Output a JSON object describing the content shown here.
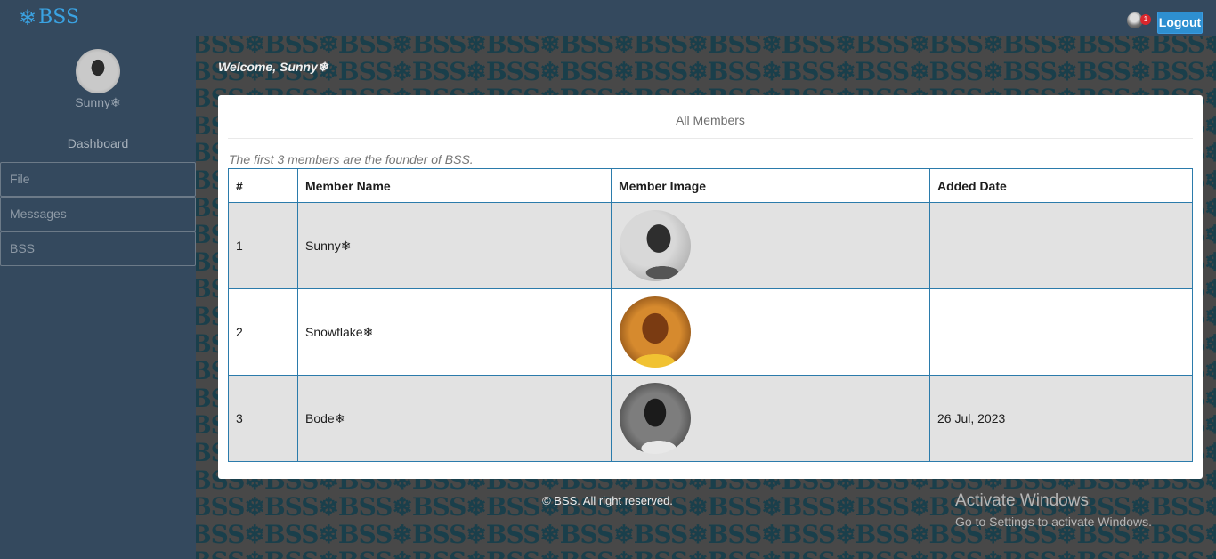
{
  "header": {
    "brand_icon": "❄",
    "brand_name": "BSS",
    "notification_count": "1",
    "logout_label": "Logout"
  },
  "sidebar": {
    "user_name": "Sunny❄",
    "dashboard_label": "Dashboard",
    "items": [
      {
        "label": "File"
      },
      {
        "label": "Messages"
      },
      {
        "label": "BSS"
      }
    ]
  },
  "main": {
    "welcome": "Welcome, Sunny❄",
    "card_title": "All Members",
    "founder_note": "The first 3 members are the founder of BSS.",
    "columns": [
      "#",
      "Member Name",
      "Member Image",
      "Added Date"
    ],
    "rows": [
      {
        "num": "1",
        "name": "Sunny❄",
        "date": ""
      },
      {
        "num": "2",
        "name": "Snowflake❄",
        "date": ""
      },
      {
        "num": "3",
        "name": "Bode❄",
        "date": "26 Jul, 2023"
      }
    ],
    "footer": "© BSS. All right reserved."
  },
  "overlay": {
    "activate_title": "Activate Windows",
    "activate_sub": "Go to Settings to activate Windows."
  },
  "colors": {
    "topbar": "#34495e",
    "sidebar": "#34495e",
    "brand": "#3aa3e3",
    "logout": "#2e8fd0",
    "table_border": "#2b7bab",
    "row_shade": "#e2e2e2"
  }
}
